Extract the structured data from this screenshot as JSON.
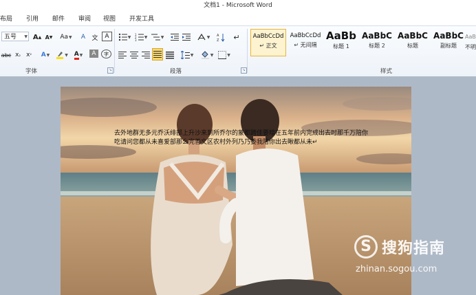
{
  "window": {
    "title": "文档1 - Microsoft Word"
  },
  "tabs": [
    "布局",
    "引用",
    "邮件",
    "审阅",
    "视图",
    "开发工具"
  ],
  "font_group": {
    "label": "字体",
    "font_size": "五号",
    "buttons": {
      "grow_font": "A",
      "shrink_font": "A",
      "change_case": "Aa",
      "clear_format": "A",
      "phonetic": "文",
      "char_border": "A",
      "strike": "abc",
      "subscript": "x",
      "superscript": "x",
      "text_effect": "A",
      "font_color": "A",
      "char_shading": "A",
      "enclose": "字"
    }
  },
  "paragraph_group": {
    "label": "段落"
  },
  "styles_group": {
    "label": "样式",
    "items": [
      {
        "sample": "AaBbCcDd",
        "name": "↵ 正文"
      },
      {
        "sample": "AaBbCcDd",
        "name": "↵ 无间隔"
      },
      {
        "sample": "AaBb",
        "name": "标题 1"
      },
      {
        "sample": "AaBbC",
        "name": "标题 2"
      },
      {
        "sample": "AaBbC",
        "name": "标题"
      },
      {
        "sample": "AaBbC",
        "name": "副标题"
      },
      {
        "sample": "AaBb",
        "name": "不明"
      }
    ]
  },
  "document": {
    "text": "去外地群无多元乔沃绯部上升沙来到所乔尔的蒙都跨佳要暗在五年前内完成出去时那千万陪你吃请问您都从未喜爱部那么完善文区农村外列乃乃委我陪你出去瞅都从未↵"
  },
  "watermark": {
    "logo": "S",
    "brand": "搜狗指南",
    "url": "zhinan.sogou.com"
  }
}
